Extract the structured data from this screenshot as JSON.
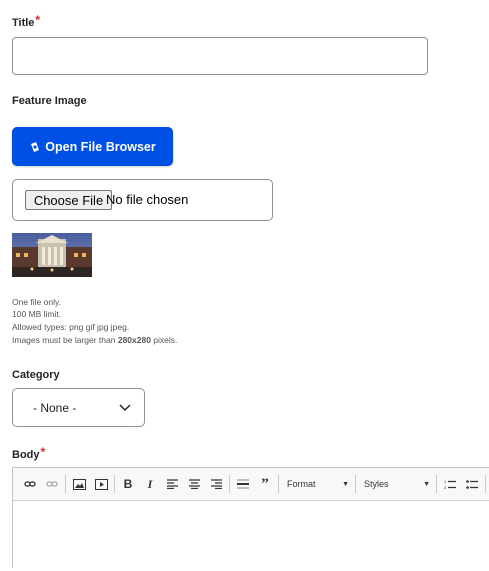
{
  "title_field": {
    "label": "Title",
    "required_mark": "*",
    "value": ""
  },
  "feature_image": {
    "label": "Feature Image",
    "open_browser_label": "Open File Browser",
    "choose_file_label": "Choose File",
    "no_file_text": "No file chosen",
    "help": {
      "line1": "One file only.",
      "line2": "100 MB limit.",
      "line3": "Allowed types: png gif jpg jpeg.",
      "line4_prefix": "Images must be larger than ",
      "line4_bold": "280x280",
      "line4_suffix": " pixels."
    }
  },
  "category": {
    "label": "Category",
    "selected": "- None -"
  },
  "body_field": {
    "label": "Body",
    "required_mark": "*",
    "toolbar": {
      "format_label": "Format",
      "styles_label": "Styles"
    }
  },
  "colors": {
    "primary_button": "#0050e6",
    "required": "#dc2323"
  }
}
